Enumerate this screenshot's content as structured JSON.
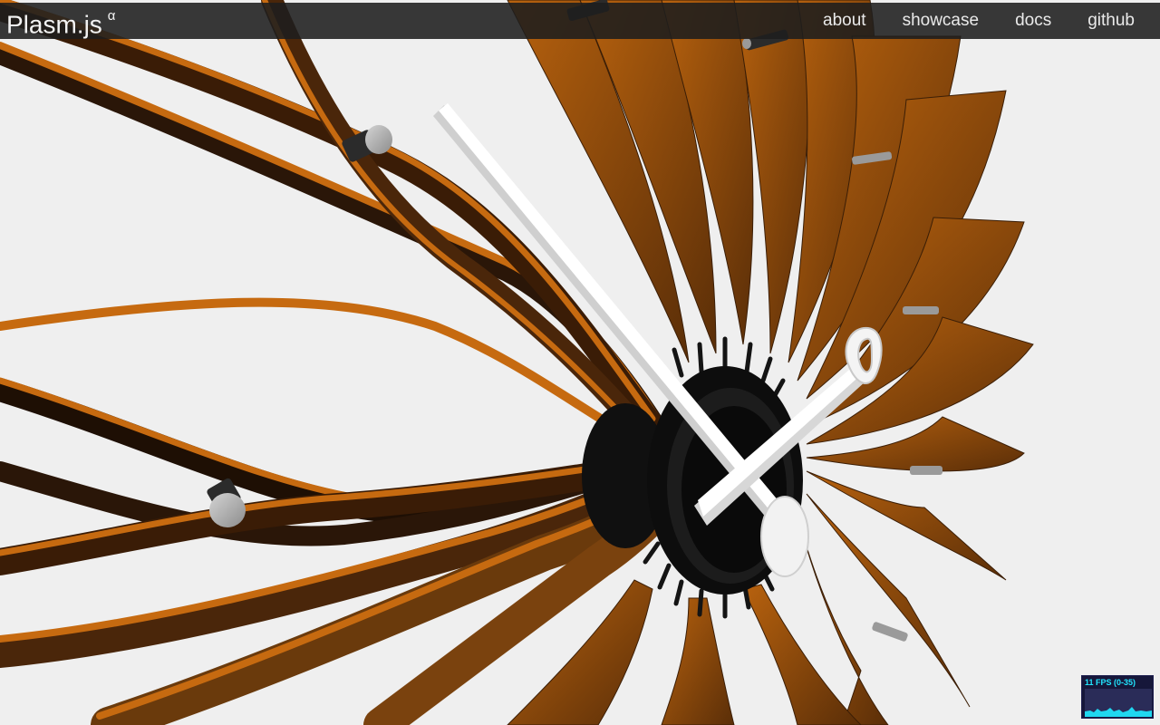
{
  "brand": {
    "name": "Plasm.js",
    "tag": "α"
  },
  "nav": {
    "items": [
      "about",
      "showcase",
      "docs",
      "github"
    ]
  },
  "fps": {
    "label": "11 FPS (0-35)",
    "current": 11,
    "min": 0,
    "max": 35
  },
  "colors": {
    "background": "#efefef",
    "topbar": "#1e1e1e",
    "ribbon_light": "#c66a10",
    "ribbon_dark": "#2a1608",
    "clock_center": "#0d0d0d",
    "hands": "#ffffff",
    "knobs": "#b3b3b3"
  }
}
